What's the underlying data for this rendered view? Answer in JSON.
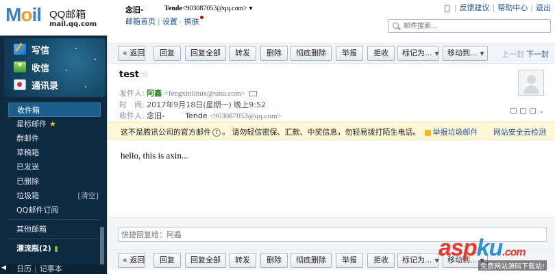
{
  "header": {
    "logo_qq": "QQ邮箱",
    "logo_url": "mail.qq.com",
    "user_name": "念旧-",
    "user_alias": "Tende",
    "user_email": "<903087053@qq.com>",
    "dropdown": "▾",
    "links": [
      "邮箱首页",
      "设置",
      "换肤"
    ],
    "top_links": [
      "反馈建议",
      "帮助中心",
      "退出"
    ],
    "search_placeholder": "邮件搜索..."
  },
  "sidebar": {
    "actions": [
      "写信",
      "收信",
      "通讯录"
    ],
    "folders": [
      {
        "label": "收件箱",
        "active": true
      },
      {
        "label": "星标邮件"
      },
      {
        "label": "群邮件"
      },
      {
        "label": "草稿箱"
      },
      {
        "label": "已发送"
      },
      {
        "label": "已删除"
      },
      {
        "label": "垃圾箱",
        "extra": "[清空]"
      },
      {
        "label": "QQ邮件订阅"
      }
    ],
    "other": "其他邮箱",
    "bottle": "漂流瓶(2)",
    "footer": [
      "日历",
      "记事本"
    ]
  },
  "toolbar": {
    "buttons": [
      "« 返回",
      "回复",
      "回复全部",
      "转发",
      "删除",
      "彻底删除",
      "举报",
      "拒收",
      "标记为...",
      "移动到..."
    ],
    "prev": "上一封",
    "next": "下一封"
  },
  "mail": {
    "subject": "test",
    "from_label": "发件人:",
    "from_name": "阿鑫",
    "from_addr": "<fengxinlinux@sina.com>",
    "time_label": "时　间:",
    "time_value": "2017年9月18日(星期一) 晚上9:52",
    "to_label": "收件人:",
    "to_name": "念旧-",
    "to_alias": "Tende",
    "to_addr": "<903087053@qq.com>",
    "warning": "这不是腾讯公司的官方邮件",
    "warning_q": "?",
    "warning_rest": "。 请勿轻信密保、汇款、中奖信息，勿轻易拨打陌生电话。",
    "report_junk": "举报垃圾邮件",
    "security_check": "网站安全云检测",
    "body": "hello, this is axin...",
    "reply_placeholder": "快捷回复给：阿鑫"
  },
  "watermark": {
    "big_a": "asp",
    "big_k": "ku",
    "dot": ".com",
    "small": "免费网站源码下载站!"
  }
}
